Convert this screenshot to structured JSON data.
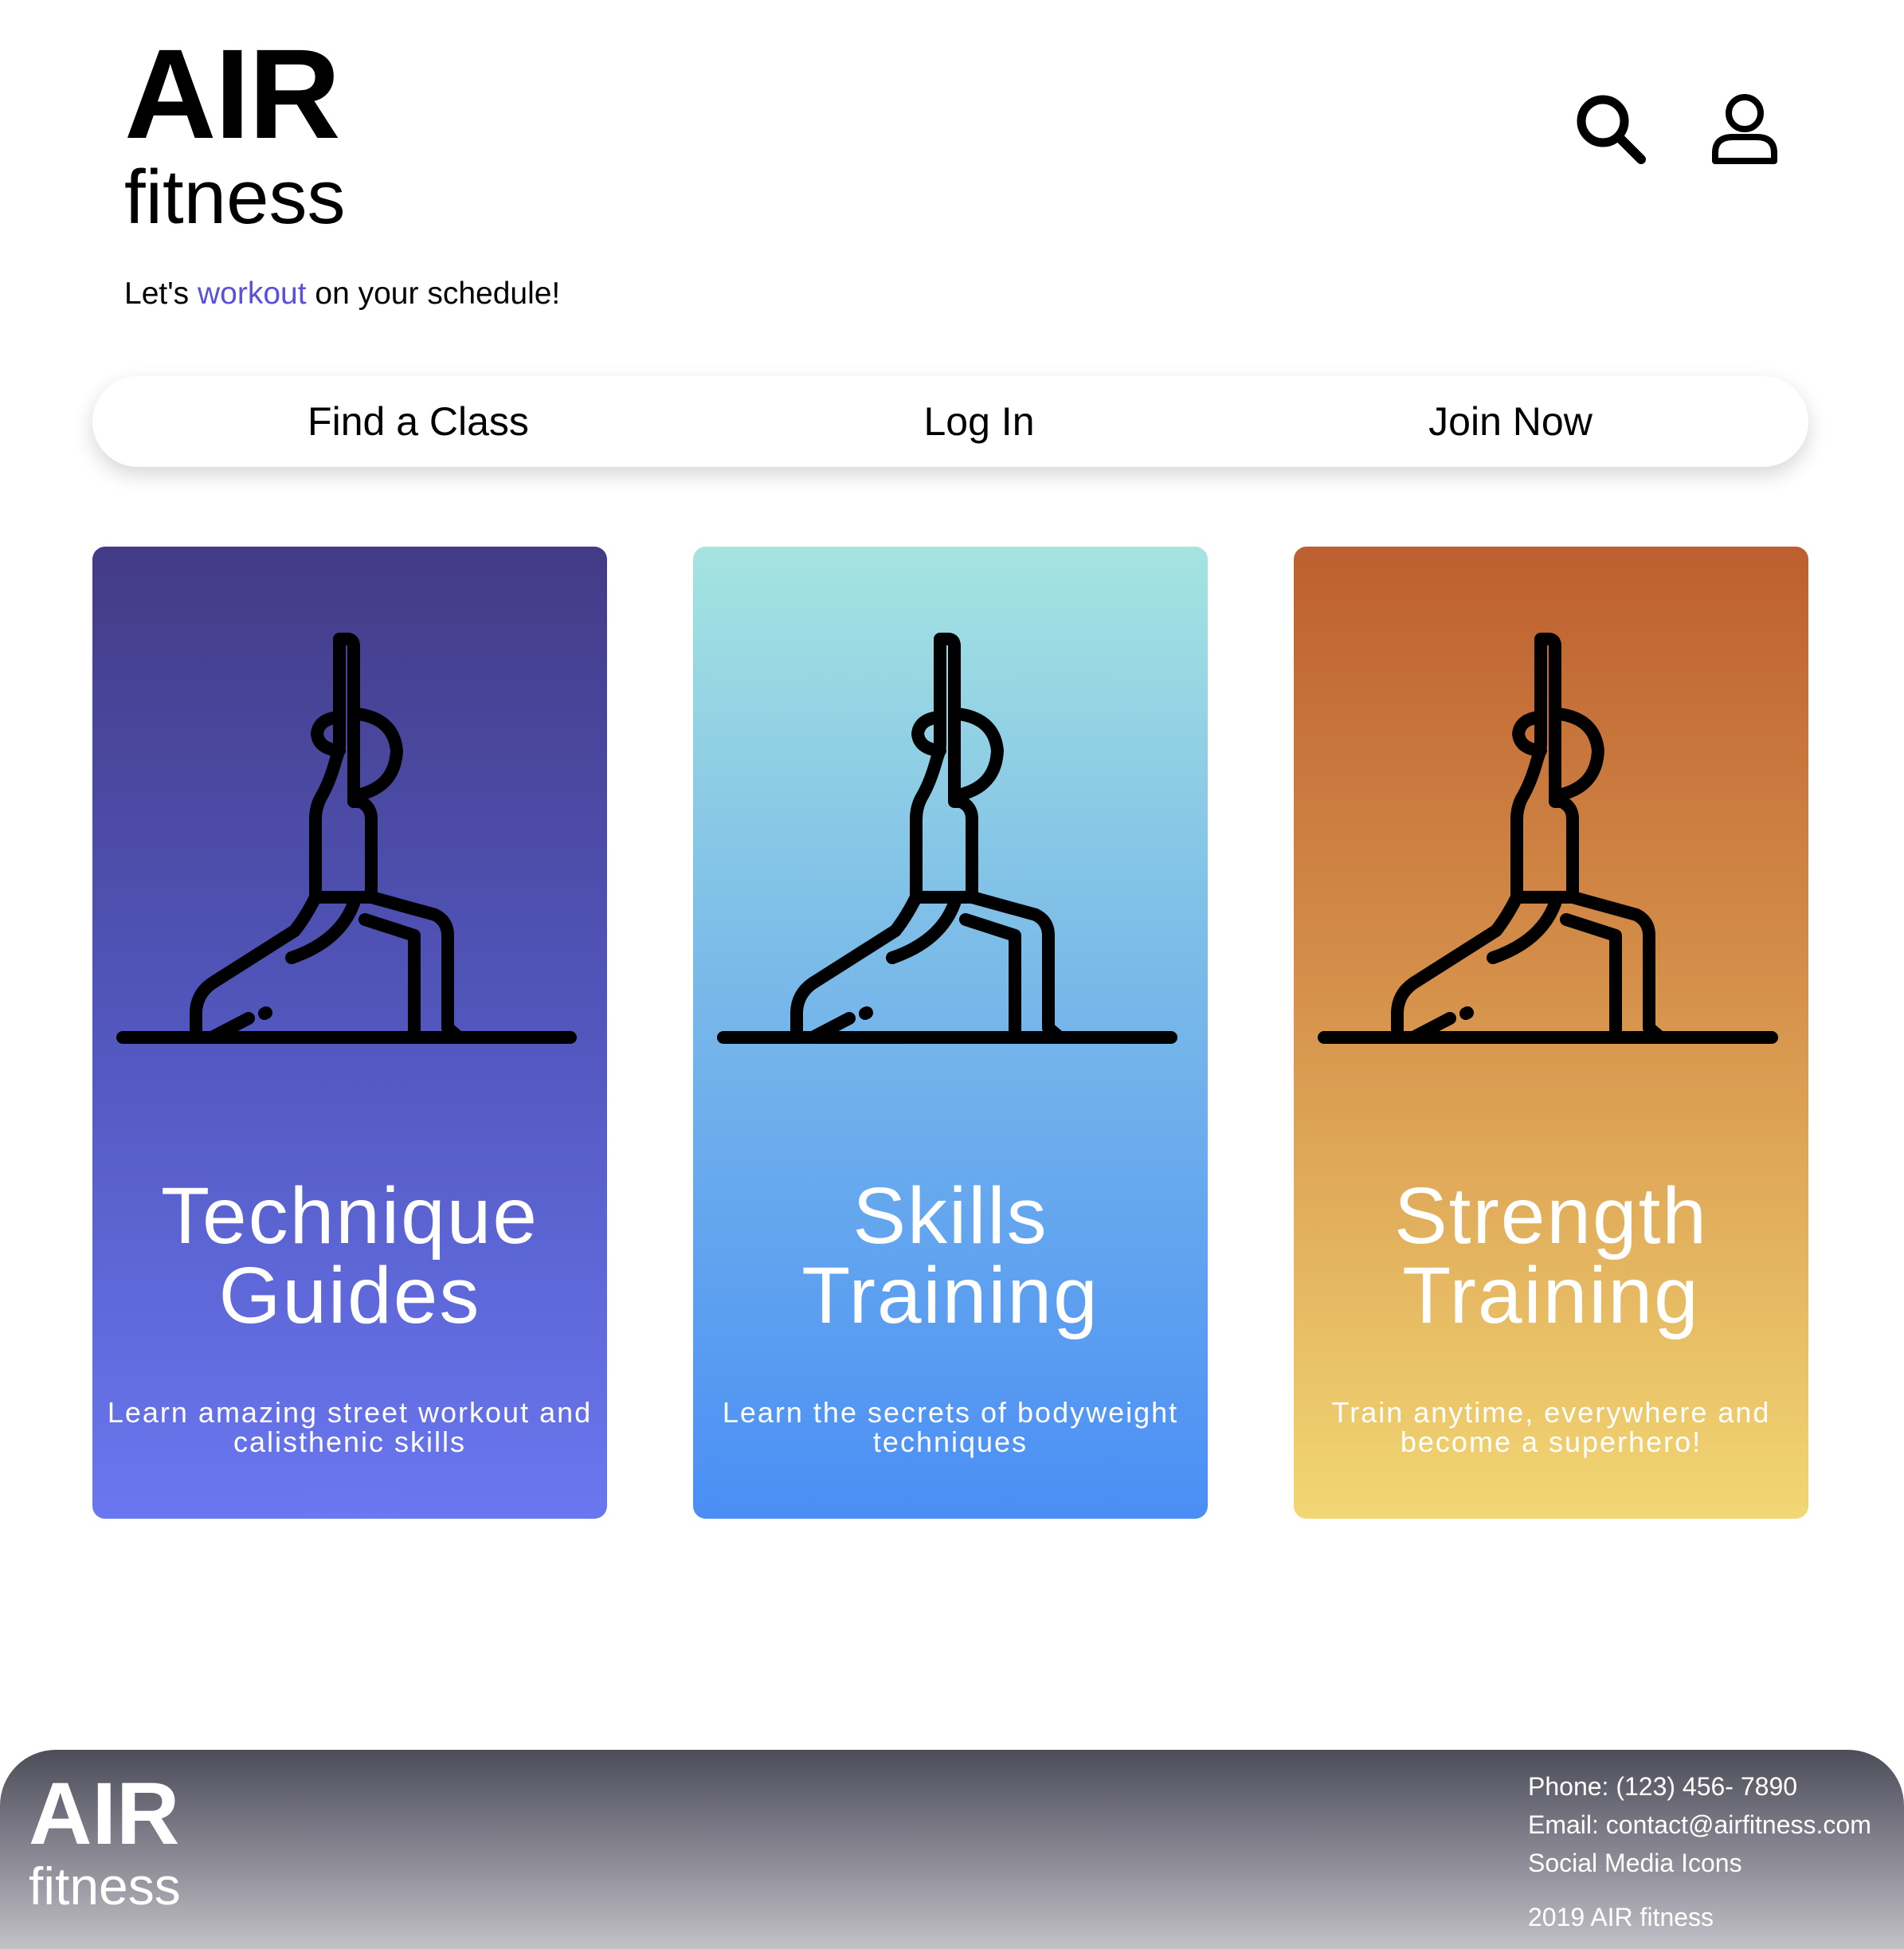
{
  "header": {
    "logo_main": "AIR",
    "logo_sub": "fitness",
    "tagline_pre": "Let's ",
    "tagline_accent": "workout",
    "tagline_post": " on your schedule!",
    "accent_color": "#5b4fdb",
    "icons": [
      "search-icon",
      "user-icon"
    ]
  },
  "nav": {
    "items": [
      {
        "label": "Find a Class"
      },
      {
        "label": "Log In"
      },
      {
        "label": "Join Now"
      }
    ]
  },
  "cards": [
    {
      "title_line1": "Technique",
      "title_line2": "Guides",
      "description": "Learn amazing street workout and calisthenic skills",
      "icon": "yoga-pose-icon",
      "gradient": [
        "#433b86",
        "#6a77f0"
      ]
    },
    {
      "title_line1": "Skills",
      "title_line2": "Training",
      "description": "Learn the secrets of bodyweight techniques",
      "icon": "yoga-pose-icon",
      "gradient": [
        "#a5e4e0",
        "#4a8ef5"
      ]
    },
    {
      "title_line1": "Strength",
      "title_line2": "Training",
      "description": "Train anytime, everywhere and become a superhero!",
      "icon": "yoga-pose-icon",
      "gradient": [
        "#bd5f30",
        "#f2d774"
      ]
    }
  ],
  "footer": {
    "logo_main": "AIR",
    "logo_sub": "fitness",
    "phone": "Phone: (123) 456- 7890",
    "email": "Email: contact@airfitness.com",
    "social": "Social Media Icons",
    "copyright": "2019 AIR fitness"
  }
}
